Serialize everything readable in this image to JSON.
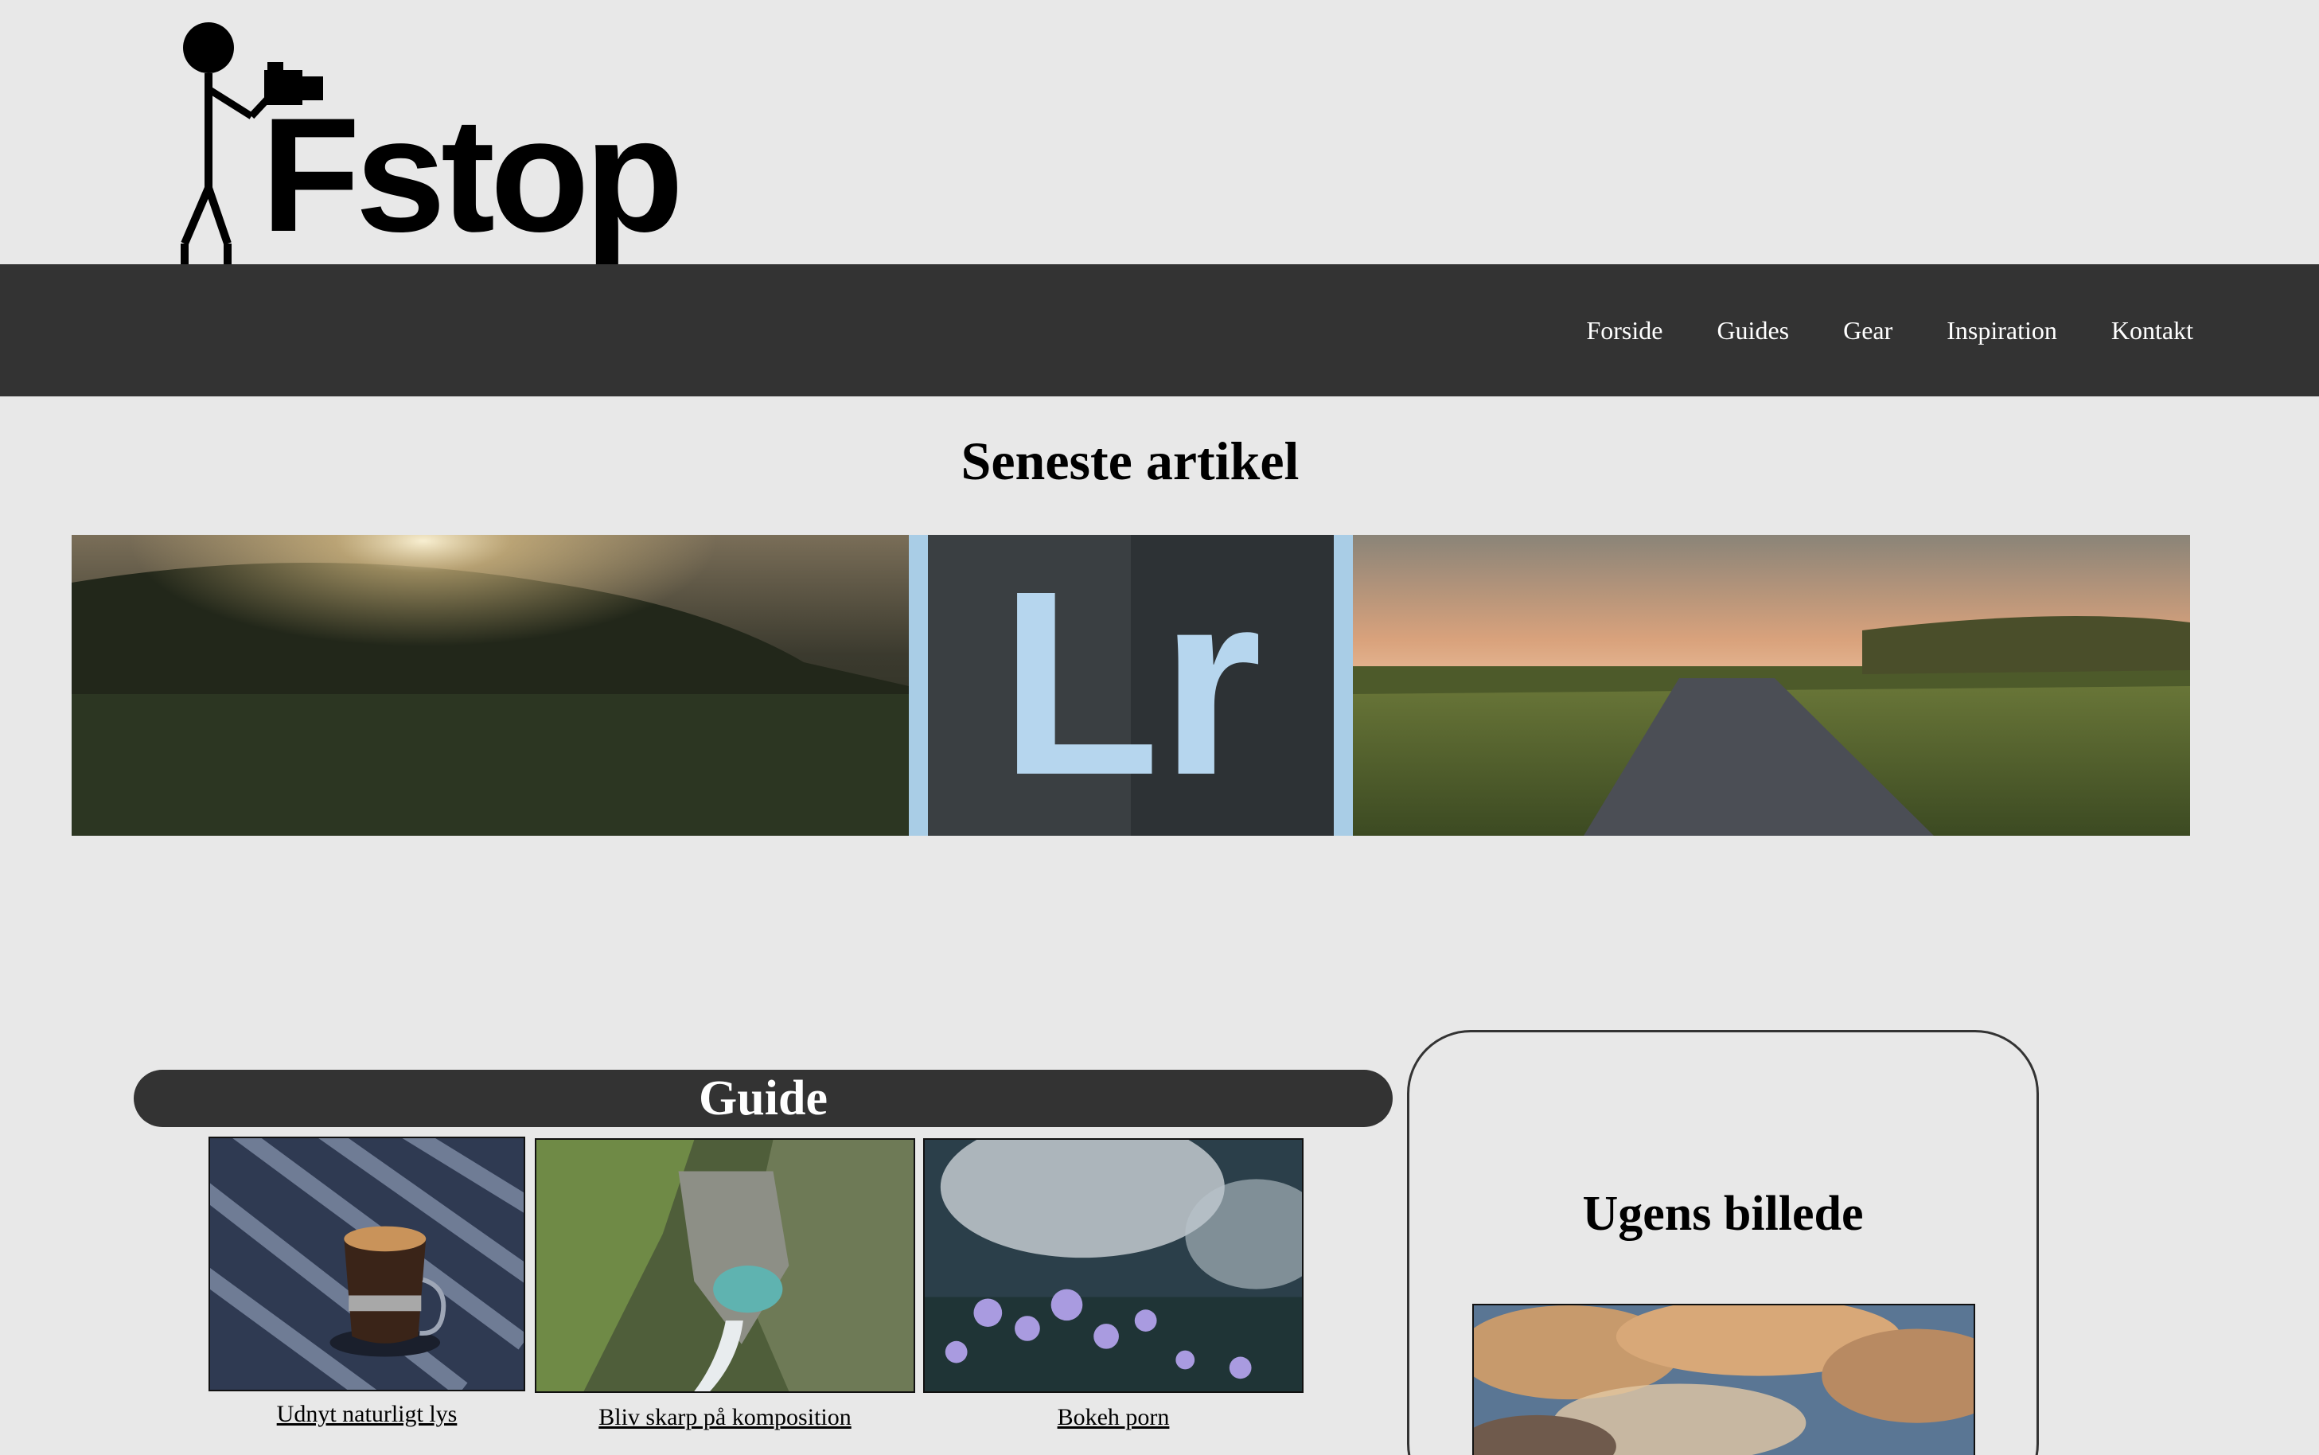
{
  "header": {
    "logo_text": "Fstop"
  },
  "nav": {
    "items": [
      {
        "label": "Forside"
      },
      {
        "label": "Guides"
      },
      {
        "label": "Gear"
      },
      {
        "label": "Inspiration"
      },
      {
        "label": "Kontakt"
      }
    ]
  },
  "latest": {
    "heading": "Seneste artikel",
    "banner_logo_text": "Lr"
  },
  "guide": {
    "heading": "Guide",
    "items": [
      {
        "label": "Udnyt naturligt lys",
        "image": "coffee-cup-photo"
      },
      {
        "label": "Bliv skarp på komposition",
        "image": "waterfall-aerial-photo"
      },
      {
        "label": "Bokeh porn",
        "image": "purple-flowers-photo"
      }
    ]
  },
  "week": {
    "heading": "Ugens billede",
    "image": "sunset-clouds-photo"
  },
  "colors": {
    "background": "#e8e8e8",
    "nav_background": "#333333",
    "nav_text": "#ffffff"
  }
}
